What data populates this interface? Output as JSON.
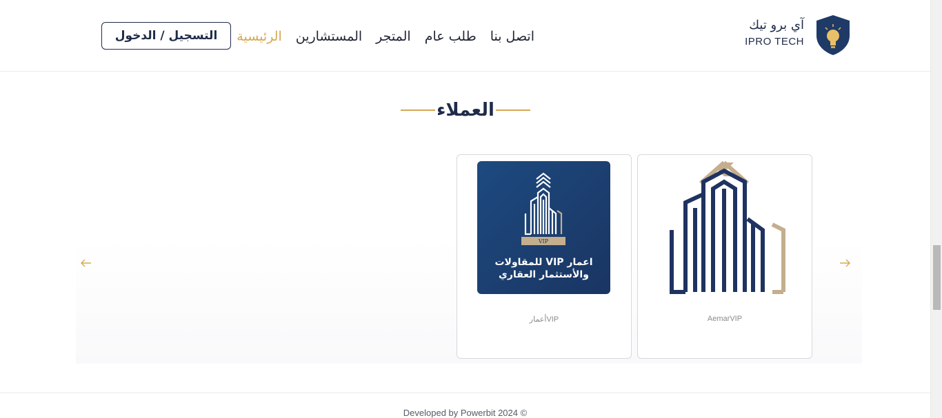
{
  "brand": {
    "name_ar": "آي برو تيك",
    "name_en": "IPRO TECH"
  },
  "nav": {
    "items": [
      {
        "label": "الرئيسية",
        "active": true
      },
      {
        "label": "المستشارين",
        "active": false
      },
      {
        "label": "المتجر",
        "active": false
      },
      {
        "label": "طلب عام",
        "active": false
      },
      {
        "label": "اتصل بنا",
        "active": false
      }
    ],
    "login_label": "التسجيل / الدخول"
  },
  "clients": {
    "title": "العملاء",
    "cards": [
      {
        "caption": "AemarVIP",
        "logo": "aemar-building-logo"
      },
      {
        "caption": "أعمارVIP",
        "logo": "aemar-vip-tile-logo",
        "tile_line1": "اعمار VIP للمقاولات",
        "tile_line2": "والأستثمار العقاري",
        "tile_badge": "VIP"
      }
    ],
    "prev_icon": "arrow-left-icon",
    "next_icon": "arrow-right-icon"
  },
  "footer": {
    "text": "Developed by Powerbit 2024 ©"
  },
  "colors": {
    "accent": "#d4a853",
    "navy": "#1f2b49",
    "tile_blue": "#1d4a80"
  }
}
